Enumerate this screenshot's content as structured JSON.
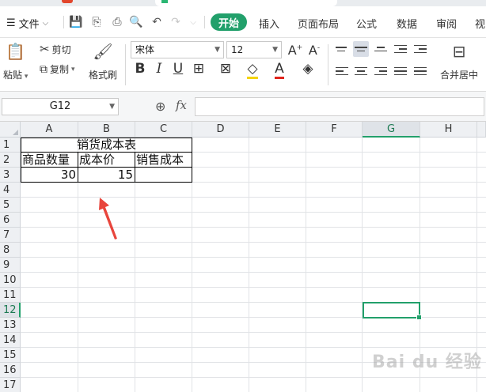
{
  "menu": {
    "file_label": "文件",
    "tabs": [
      "开始",
      "插入",
      "页面布局",
      "公式",
      "数据",
      "审阅",
      "视"
    ],
    "active_tab": "开始"
  },
  "ribbon": {
    "paste": "粘贴",
    "cut": "剪切",
    "copy": "复制",
    "format_painter": "格式刷",
    "font_name": "宋体",
    "font_size": "12",
    "merge_center": "合并居中"
  },
  "formula_bar": {
    "name_box": "G12",
    "fx": "fx",
    "formula": ""
  },
  "grid": {
    "columns": [
      "A",
      "B",
      "C",
      "D",
      "E",
      "F",
      "G",
      "H"
    ],
    "selected_column": "G",
    "rows": [
      "1",
      "2",
      "3",
      "4",
      "5",
      "6",
      "7",
      "8",
      "9",
      "10",
      "11",
      "12",
      "13",
      "14",
      "15",
      "16",
      "17"
    ],
    "selected_row": "12",
    "selected_cell": "G12"
  },
  "cells": {
    "title": "销货成本表",
    "a2": "商品数量",
    "b2": "成本价",
    "c2": "销售成本",
    "a3": "30",
    "b3": "15"
  },
  "watermark": "Bai du 经验",
  "colors": {
    "accent": "#22a06b",
    "annotation_arrow": "#e8453c"
  }
}
